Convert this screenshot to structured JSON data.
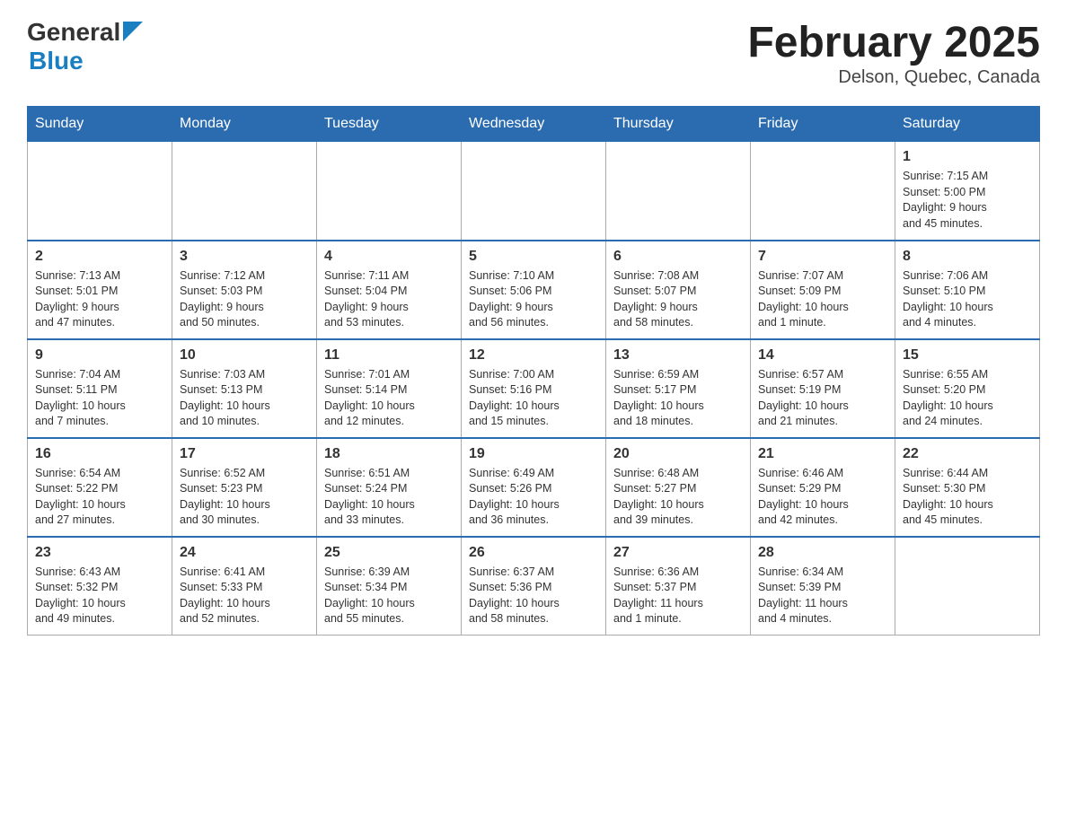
{
  "header": {
    "logo_general": "General",
    "logo_blue": "Blue",
    "month_title": "February 2025",
    "location": "Delson, Quebec, Canada"
  },
  "weekdays": [
    "Sunday",
    "Monday",
    "Tuesday",
    "Wednesday",
    "Thursday",
    "Friday",
    "Saturday"
  ],
  "weeks": [
    [
      {
        "day": "",
        "info": ""
      },
      {
        "day": "",
        "info": ""
      },
      {
        "day": "",
        "info": ""
      },
      {
        "day": "",
        "info": ""
      },
      {
        "day": "",
        "info": ""
      },
      {
        "day": "",
        "info": ""
      },
      {
        "day": "1",
        "info": "Sunrise: 7:15 AM\nSunset: 5:00 PM\nDaylight: 9 hours\nand 45 minutes."
      }
    ],
    [
      {
        "day": "2",
        "info": "Sunrise: 7:13 AM\nSunset: 5:01 PM\nDaylight: 9 hours\nand 47 minutes."
      },
      {
        "day": "3",
        "info": "Sunrise: 7:12 AM\nSunset: 5:03 PM\nDaylight: 9 hours\nand 50 minutes."
      },
      {
        "day": "4",
        "info": "Sunrise: 7:11 AM\nSunset: 5:04 PM\nDaylight: 9 hours\nand 53 minutes."
      },
      {
        "day": "5",
        "info": "Sunrise: 7:10 AM\nSunset: 5:06 PM\nDaylight: 9 hours\nand 56 minutes."
      },
      {
        "day": "6",
        "info": "Sunrise: 7:08 AM\nSunset: 5:07 PM\nDaylight: 9 hours\nand 58 minutes."
      },
      {
        "day": "7",
        "info": "Sunrise: 7:07 AM\nSunset: 5:09 PM\nDaylight: 10 hours\nand 1 minute."
      },
      {
        "day": "8",
        "info": "Sunrise: 7:06 AM\nSunset: 5:10 PM\nDaylight: 10 hours\nand 4 minutes."
      }
    ],
    [
      {
        "day": "9",
        "info": "Sunrise: 7:04 AM\nSunset: 5:11 PM\nDaylight: 10 hours\nand 7 minutes."
      },
      {
        "day": "10",
        "info": "Sunrise: 7:03 AM\nSunset: 5:13 PM\nDaylight: 10 hours\nand 10 minutes."
      },
      {
        "day": "11",
        "info": "Sunrise: 7:01 AM\nSunset: 5:14 PM\nDaylight: 10 hours\nand 12 minutes."
      },
      {
        "day": "12",
        "info": "Sunrise: 7:00 AM\nSunset: 5:16 PM\nDaylight: 10 hours\nand 15 minutes."
      },
      {
        "day": "13",
        "info": "Sunrise: 6:59 AM\nSunset: 5:17 PM\nDaylight: 10 hours\nand 18 minutes."
      },
      {
        "day": "14",
        "info": "Sunrise: 6:57 AM\nSunset: 5:19 PM\nDaylight: 10 hours\nand 21 minutes."
      },
      {
        "day": "15",
        "info": "Sunrise: 6:55 AM\nSunset: 5:20 PM\nDaylight: 10 hours\nand 24 minutes."
      }
    ],
    [
      {
        "day": "16",
        "info": "Sunrise: 6:54 AM\nSunset: 5:22 PM\nDaylight: 10 hours\nand 27 minutes."
      },
      {
        "day": "17",
        "info": "Sunrise: 6:52 AM\nSunset: 5:23 PM\nDaylight: 10 hours\nand 30 minutes."
      },
      {
        "day": "18",
        "info": "Sunrise: 6:51 AM\nSunset: 5:24 PM\nDaylight: 10 hours\nand 33 minutes."
      },
      {
        "day": "19",
        "info": "Sunrise: 6:49 AM\nSunset: 5:26 PM\nDaylight: 10 hours\nand 36 minutes."
      },
      {
        "day": "20",
        "info": "Sunrise: 6:48 AM\nSunset: 5:27 PM\nDaylight: 10 hours\nand 39 minutes."
      },
      {
        "day": "21",
        "info": "Sunrise: 6:46 AM\nSunset: 5:29 PM\nDaylight: 10 hours\nand 42 minutes."
      },
      {
        "day": "22",
        "info": "Sunrise: 6:44 AM\nSunset: 5:30 PM\nDaylight: 10 hours\nand 45 minutes."
      }
    ],
    [
      {
        "day": "23",
        "info": "Sunrise: 6:43 AM\nSunset: 5:32 PM\nDaylight: 10 hours\nand 49 minutes."
      },
      {
        "day": "24",
        "info": "Sunrise: 6:41 AM\nSunset: 5:33 PM\nDaylight: 10 hours\nand 52 minutes."
      },
      {
        "day": "25",
        "info": "Sunrise: 6:39 AM\nSunset: 5:34 PM\nDaylight: 10 hours\nand 55 minutes."
      },
      {
        "day": "26",
        "info": "Sunrise: 6:37 AM\nSunset: 5:36 PM\nDaylight: 10 hours\nand 58 minutes."
      },
      {
        "day": "27",
        "info": "Sunrise: 6:36 AM\nSunset: 5:37 PM\nDaylight: 11 hours\nand 1 minute."
      },
      {
        "day": "28",
        "info": "Sunrise: 6:34 AM\nSunset: 5:39 PM\nDaylight: 11 hours\nand 4 minutes."
      },
      {
        "day": "",
        "info": ""
      }
    ]
  ]
}
